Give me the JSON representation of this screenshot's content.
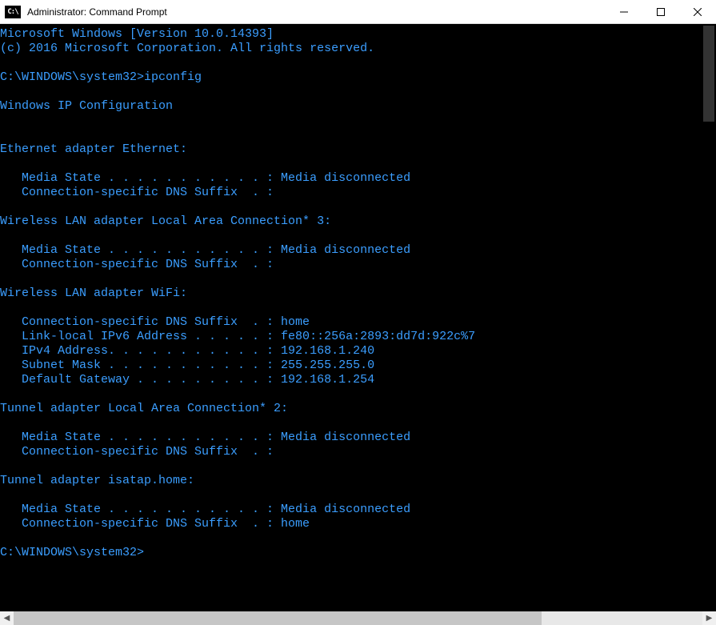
{
  "window": {
    "title": "Administrator: Command Prompt",
    "icon_text": "C:\\"
  },
  "terminal": {
    "header": {
      "line1": "Microsoft Windows [Version 10.0.14393]",
      "line2": "(c) 2016 Microsoft Corporation. All rights reserved."
    },
    "prompt1": "C:\\WINDOWS\\system32>ipconfig",
    "config_title": "Windows IP Configuration",
    "adapter1": {
      "header": "Ethernet adapter Ethernet:",
      "media_state": "   Media State . . . . . . . . . . . : Media disconnected",
      "dns_suffix": "   Connection-specific DNS Suffix  . :"
    },
    "adapter2": {
      "header": "Wireless LAN adapter Local Area Connection* 3:",
      "media_state": "   Media State . . . . . . . . . . . : Media disconnected",
      "dns_suffix": "   Connection-specific DNS Suffix  . :"
    },
    "adapter3": {
      "header": "Wireless LAN adapter WiFi:",
      "dns_suffix": "   Connection-specific DNS Suffix  . : home",
      "ipv6": "   Link-local IPv6 Address . . . . . : fe80::256a:2893:dd7d:922c%7",
      "ipv4": "   IPv4 Address. . . . . . . . . . . : 192.168.1.240",
      "subnet": "   Subnet Mask . . . . . . . . . . . : 255.255.255.0",
      "gateway": "   Default Gateway . . . . . . . . . : 192.168.1.254"
    },
    "adapter4": {
      "header": "Tunnel adapter Local Area Connection* 2:",
      "media_state": "   Media State . . . . . . . . . . . : Media disconnected",
      "dns_suffix": "   Connection-specific DNS Suffix  . :"
    },
    "adapter5": {
      "header": "Tunnel adapter isatap.home:",
      "media_state": "   Media State . . . . . . . . . . . : Media disconnected",
      "dns_suffix": "   Connection-specific DNS Suffix  . : home"
    },
    "prompt2": "C:\\WINDOWS\\system32>"
  }
}
